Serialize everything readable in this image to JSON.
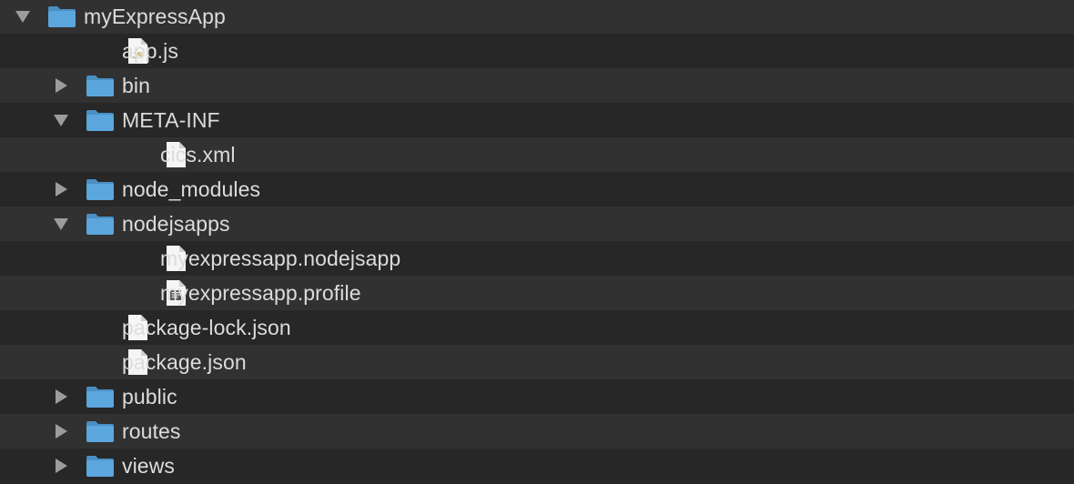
{
  "tree": {
    "rows": [
      {
        "label": "myExpressApp",
        "depth": 0,
        "kind": "folder",
        "toggle": "expanded"
      },
      {
        "label": "app.js",
        "depth": 1,
        "kind": "js",
        "toggle": "none",
        "badge": "JS"
      },
      {
        "label": "bin",
        "depth": 1,
        "kind": "folder",
        "toggle": "collapsed"
      },
      {
        "label": "META-INF",
        "depth": 1,
        "kind": "folder",
        "toggle": "expanded"
      },
      {
        "label": "cics.xml",
        "depth": 2,
        "kind": "file",
        "toggle": "none"
      },
      {
        "label": "node_modules",
        "depth": 1,
        "kind": "folder",
        "toggle": "collapsed"
      },
      {
        "label": "nodejsapps",
        "depth": 1,
        "kind": "folder",
        "toggle": "expanded"
      },
      {
        "label": "myexpressapp.nodejsapp",
        "depth": 2,
        "kind": "file",
        "toggle": "none"
      },
      {
        "label": "myexpressapp.profile",
        "depth": 2,
        "kind": "text",
        "toggle": "none"
      },
      {
        "label": "package-lock.json",
        "depth": 1,
        "kind": "file",
        "toggle": "none"
      },
      {
        "label": "package.json",
        "depth": 1,
        "kind": "file",
        "toggle": "none"
      },
      {
        "label": "public",
        "depth": 1,
        "kind": "folder",
        "toggle": "collapsed"
      },
      {
        "label": "routes",
        "depth": 1,
        "kind": "folder",
        "toggle": "collapsed"
      },
      {
        "label": "views",
        "depth": 1,
        "kind": "folder",
        "toggle": "collapsed"
      }
    ]
  },
  "colors": {
    "folder": "#5ba6dd",
    "folder_tab": "#4a8fc4",
    "file": "#f5f5f5",
    "text": "#dcdcdc",
    "triangle": "#9c9c9c",
    "row_odd": "#313131",
    "row_even": "#272727",
    "js_badge": "#b6a23a"
  }
}
